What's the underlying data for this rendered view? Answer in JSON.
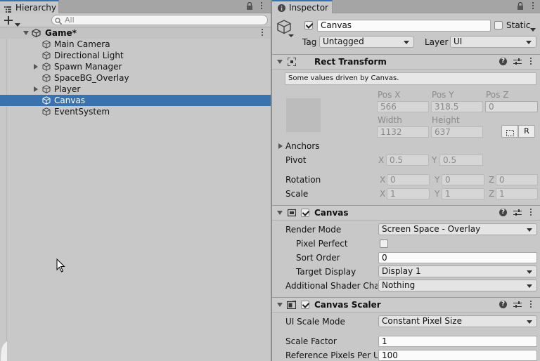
{
  "hierarchy": {
    "tab_label": "Hierarchy",
    "search_placeholder": "All",
    "scene_name": "Game*",
    "items": [
      {
        "label": "Main Camera"
      },
      {
        "label": "Directional Light"
      },
      {
        "label": "Spawn Manager"
      },
      {
        "label": "SpaceBG_Overlay"
      },
      {
        "label": "Player"
      },
      {
        "label": "Canvas"
      },
      {
        "label": "EventSystem"
      }
    ]
  },
  "inspector": {
    "tab_label": "Inspector",
    "object_name": "Canvas",
    "static_label": "Static",
    "tag_label": "Tag",
    "tag_value": "Untagged",
    "layer_label": "Layer",
    "layer_value": "UI",
    "rect_transform": {
      "title": "Rect Transform",
      "note": "Some values driven by Canvas.",
      "pos_x_label": "Pos X",
      "pos_x": "566",
      "pos_y_label": "Pos Y",
      "pos_y": "318.5",
      "pos_z_label": "Pos Z",
      "pos_z": "0",
      "width_label": "Width",
      "width": "1132",
      "height_label": "Height",
      "height": "637",
      "r_button": "R",
      "anchors_label": "Anchors",
      "pivot_label": "Pivot",
      "pivot_x": "0.5",
      "pivot_y": "0.5",
      "rotation_label": "Rotation",
      "rot_x": "0",
      "rot_y": "0",
      "rot_z": "0",
      "scale_label": "Scale",
      "scale_x": "1",
      "scale_y": "1",
      "scale_z": "1",
      "x": "X",
      "y": "Y",
      "z": "Z"
    },
    "canvas": {
      "title": "Canvas",
      "render_mode_label": "Render Mode",
      "render_mode_value": "Screen Space - Overlay",
      "pixel_perfect_label": "Pixel Perfect",
      "sort_order_label": "Sort Order",
      "sort_order_value": "0",
      "target_display_label": "Target Display",
      "target_display_value": "Display 1",
      "shader_channels_label": "Additional Shader Chan",
      "shader_channels_value": "Nothing"
    },
    "canvas_scaler": {
      "title": "Canvas Scaler",
      "ui_scale_mode_label": "UI Scale Mode",
      "ui_scale_mode_value": "Constant Pixel Size",
      "scale_factor_label": "Scale Factor",
      "scale_factor_value": "1",
      "ref_pixels_label": "Reference Pixels Per Ur",
      "ref_pixels_value": "100"
    }
  }
}
